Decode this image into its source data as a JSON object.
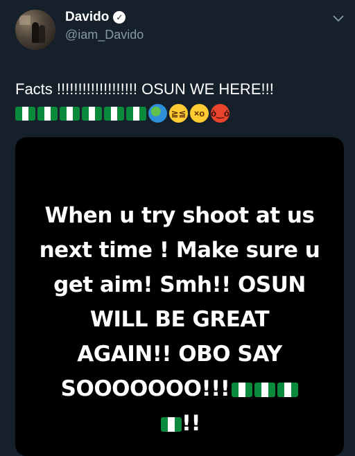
{
  "author": {
    "display_name": "Davido",
    "handle": "@iam_Davido"
  },
  "tweet": {
    "text": "Facts !!!!!!!!!!!!!!!!!!! OSUN WE HERE!!!",
    "emojis": [
      "nigeria-flag",
      "nigeria-flag",
      "nigeria-flag",
      "nigeria-flag",
      "nigeria-flag",
      "nigeria-flag",
      "globe-africa",
      "laughing-face",
      "astonished-face",
      "angry-face"
    ]
  },
  "media": {
    "lines": [
      "When u try shoot at us",
      "next time ! Make sure u",
      "get aim! Smh!! OSUN",
      "WILL BE GREAT",
      "AGAIN!! OBO SAY",
      "SOOOOOOO!!!",
      "!!"
    ]
  },
  "colors": {
    "background": "#15202b",
    "secondary_text": "#8899a6",
    "flag_green": "#0b8a3e"
  }
}
